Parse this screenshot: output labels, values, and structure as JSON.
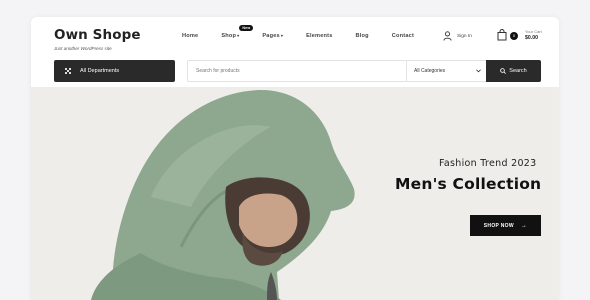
{
  "brand": {
    "title": "Own Shope",
    "tagline": "Just another WordPress site"
  },
  "nav": {
    "items": [
      {
        "label": "Home"
      },
      {
        "label": "Shop",
        "caret": "▾",
        "badge": "New"
      },
      {
        "label": "Pages",
        "caret": "▾"
      },
      {
        "label": "Elements"
      },
      {
        "label": "Blog"
      },
      {
        "label": "Contact"
      }
    ]
  },
  "account": {
    "signin_label": "Sign In",
    "icon": "user-icon"
  },
  "cart": {
    "icon": "shopping-bag-icon",
    "label": "Your Cart",
    "count": "0",
    "total": "$0.00"
  },
  "departments": {
    "label": "All Departments",
    "icon": "grid-icon"
  },
  "search": {
    "placeholder": "Search for products",
    "category_selected": "All Categories",
    "button_label": "Search"
  },
  "hero": {
    "tagline": "Fashion Trend 2023",
    "title": "Men's Collection",
    "cta_label": "SHOP NOW",
    "cta_icon": "arrow-right-icon"
  },
  "colors": {
    "accent": "#111111",
    "dark_bar": "#2a2a2a",
    "hero_bg": "#efede9",
    "hoodie": "#8faa91"
  }
}
